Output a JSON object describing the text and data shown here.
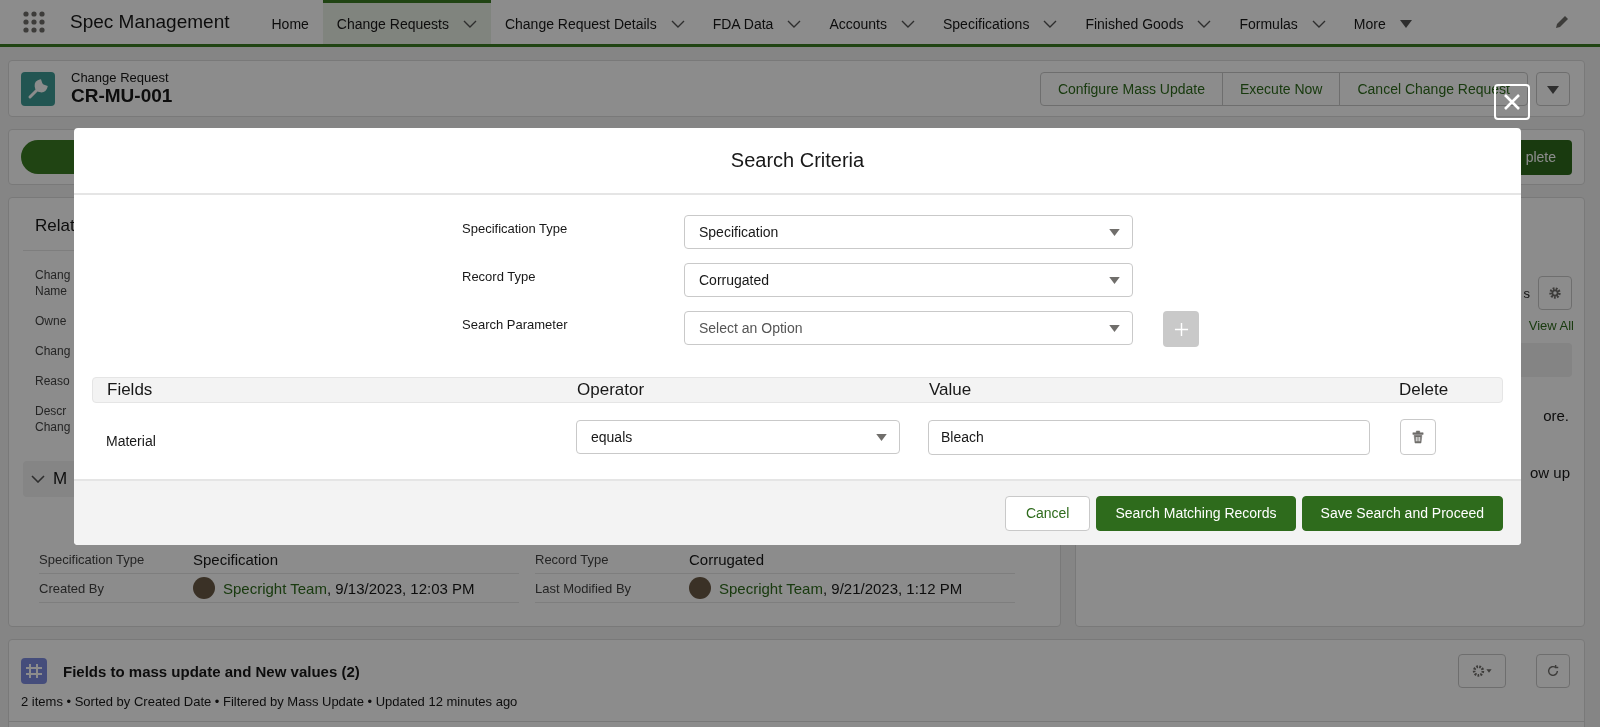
{
  "nav": {
    "app_name": "Spec Management",
    "items": [
      {
        "label": "Home",
        "selected": false,
        "kind": "plain"
      },
      {
        "label": "Change Requests",
        "selected": true,
        "kind": "chevron"
      },
      {
        "label": "Change Request Details",
        "selected": false,
        "kind": "chevron"
      },
      {
        "label": "FDA Data",
        "selected": false,
        "kind": "chevron"
      },
      {
        "label": "Accounts",
        "selected": false,
        "kind": "chevron"
      },
      {
        "label": "Specifications",
        "selected": false,
        "kind": "chevron"
      },
      {
        "label": "Finished Goods",
        "selected": false,
        "kind": "chevron"
      },
      {
        "label": "Formulas",
        "selected": false,
        "kind": "chevron"
      },
      {
        "label": "More",
        "selected": false,
        "kind": "triangle"
      }
    ]
  },
  "record_header": {
    "object_label": "Change Request",
    "record_name": "CR-MU-001",
    "actions": [
      "Configure Mass Update",
      "Execute Now",
      "Cancel Change Request"
    ]
  },
  "path": {
    "button_label": "plete"
  },
  "details_card": {
    "title": "Relat",
    "fields": [
      [
        "Chang",
        "Name"
      ],
      [
        "Owne"
      ],
      [
        "Chang"
      ],
      [
        "Reaso"
      ],
      [
        "Descr",
        "Chang"
      ]
    ],
    "section": {
      "title": "M",
      "expanded": true
    },
    "rows": [
      [
        {
          "label": "Specification Type",
          "value": "Specification"
        },
        {
          "label": "Record Type",
          "value": "Corrugated"
        }
      ],
      [
        {
          "label": "Created By",
          "user": "Specright Team",
          "date": ", 9/13/2023, 12:03 PM"
        },
        {
          "label": "Last Modified By",
          "user": "Specright Team",
          "date": ", 9/21/2023, 1:12 PM"
        }
      ]
    ]
  },
  "side_card": {
    "title_fragment": "s",
    "link": "View All",
    "text_1": "ore.",
    "text_2": "ow up"
  },
  "related_list": {
    "title": "Fields to mass update and New values (2)",
    "meta": "2 items • Sorted by Created Date • Filtered by Mass Update • Updated 12 minutes ago"
  },
  "modal": {
    "title": "Search Criteria",
    "criteria": [
      {
        "label": "Specification Type",
        "value": "Specification"
      },
      {
        "label": "Record Type",
        "value": "Corrugated"
      },
      {
        "label": "Search Parameter",
        "placeholder": "Select an Option"
      }
    ],
    "add_button": {
      "disabled": true
    },
    "table": {
      "columns": [
        "Fields",
        "Operator",
        "Value",
        "Delete"
      ],
      "rows": [
        {
          "field": "Material",
          "operator": "equals",
          "value": "Bleach"
        }
      ]
    },
    "buttons": [
      {
        "label": "Cancel",
        "kind": "neutral"
      },
      {
        "label": "Search Matching Records",
        "kind": "brand"
      },
      {
        "label": "Save Search and Proceed",
        "kind": "brand"
      }
    ]
  }
}
